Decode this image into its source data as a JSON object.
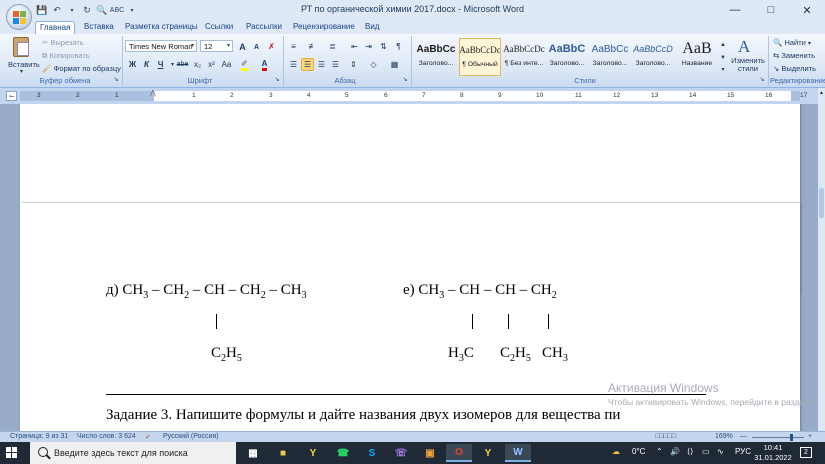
{
  "window": {
    "title": "РТ по органической химии  2017.docx - Microsoft Word",
    "minimize_icon": "minimize-icon",
    "maximize_icon": "maximize-icon",
    "close_icon": "close-icon"
  },
  "ribbon_tabs": [
    "Главная",
    "Вставка",
    "Разметка страницы",
    "Ссылки",
    "Рассылки",
    "Рецензирование",
    "Вид"
  ],
  "ribbon": {
    "clipboard": {
      "paste_label": "Вставить",
      "cut_label": "Вырезать",
      "copy_label": "Копировать",
      "format_painter_label": "Формат по образцу",
      "group_label": "Буфер обмена"
    },
    "font": {
      "font_name": "Times New Roman",
      "font_size": "12",
      "bold": "Ж",
      "italic": "К",
      "underline": "Ч",
      "strike": "abe",
      "subscript": "x₂",
      "superscript": "x²",
      "case": "Aa",
      "grow": "A",
      "shrink": "A",
      "group_label": "Шрифт"
    },
    "paragraph": {
      "group_label": "Абзац"
    },
    "styles": {
      "items": [
        {
          "sample": "AaBbCc",
          "caption": "Заголово..."
        },
        {
          "sample": "AaBbCcDc",
          "caption": "¶ Обычный"
        },
        {
          "sample": "AaBbCcDc",
          "caption": "¶ Без инте..."
        },
        {
          "sample": "AaBbC",
          "caption": "Заголово..."
        },
        {
          "sample": "AaBbCc",
          "caption": "Заголово..."
        },
        {
          "sample": "AaBbCcD",
          "caption": "Заголово..."
        },
        {
          "sample": "AaB",
          "caption": "Название"
        }
      ],
      "change_styles_label": "Изменить стили",
      "group_label": "Стили"
    },
    "editing": {
      "find_label": "Найти",
      "replace_label": "Заменить",
      "select_label": "Выделить",
      "group_label": "Редактирование"
    }
  },
  "ruler": {
    "numbers": [
      "3",
      "2",
      "1",
      "1",
      "2",
      "3",
      "4",
      "5",
      "6",
      "7",
      "8",
      "9",
      "10",
      "11",
      "12",
      "13",
      "14",
      "15",
      "16",
      "17"
    ]
  },
  "document": {
    "formula_d": {
      "label": "д)",
      "main": [
        "CH",
        "3",
        " – CH",
        "2",
        " – CH – CH",
        "2",
        " – CH",
        "3"
      ],
      "branch": [
        "C",
        "2",
        "H",
        "5"
      ]
    },
    "formula_e": {
      "label": "е)",
      "main": [
        "CH",
        "3",
        " – CH – CH – CH",
        "2"
      ],
      "branch1": [
        "H",
        "3",
        "C"
      ],
      "branch2": [
        "C",
        "2",
        "H",
        "5"
      ],
      "branch3": [
        "CH",
        "3"
      ]
    },
    "task_text": "Задание 3.  Напишите формулы и дайте названия двух изомеров для вещества пи",
    "watermark_title": "Активация Windows",
    "watermark_text": "Чтобы активировать Windows, перейдите в раздел \"Параметры\"."
  },
  "status_bar": {
    "page": "Страница: 9 из 31",
    "words": "Число слов: 3 624",
    "language": "Русский (Россия)",
    "zoom": "169%"
  },
  "taskbar": {
    "search_placeholder": "Введите здесь текст для поиска",
    "weather": "0°C",
    "language": "РУС",
    "time": "10:41",
    "date": "31.01.2022",
    "notifications": "2"
  },
  "colors": {
    "ribbon_bg": "#dbe6f5",
    "accent": "#15428b",
    "taskbar": "#1f2a36",
    "doc_bg": "#98acc9"
  }
}
